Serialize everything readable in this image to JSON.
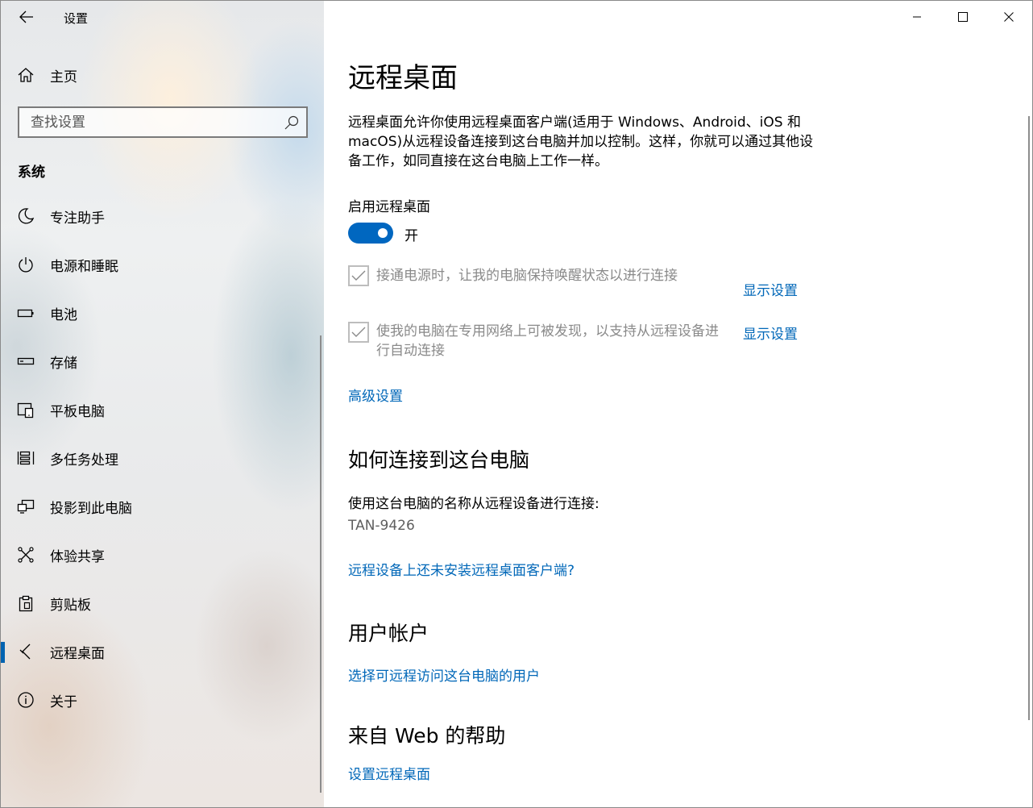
{
  "window": {
    "title": "设置",
    "controls": {
      "minimize": "minimize",
      "maximize": "maximize",
      "close": "close"
    }
  },
  "sidebar": {
    "home_label": "主页",
    "search_placeholder": "查找设置",
    "section": "系统",
    "items": [
      {
        "label": "专注助手",
        "icon": "moon-icon"
      },
      {
        "label": "电源和睡眠",
        "icon": "power-icon"
      },
      {
        "label": "电池",
        "icon": "battery-icon"
      },
      {
        "label": "存储",
        "icon": "storage-icon"
      },
      {
        "label": "平板电脑",
        "icon": "tablet-icon"
      },
      {
        "label": "多任务处理",
        "icon": "multitasking-icon"
      },
      {
        "label": "投影到此电脑",
        "icon": "project-icon"
      },
      {
        "label": "体验共享",
        "icon": "share-icon"
      },
      {
        "label": "剪贴板",
        "icon": "clipboard-icon"
      },
      {
        "label": "远程桌面",
        "icon": "remote-desktop-icon",
        "active": true
      },
      {
        "label": "关于",
        "icon": "info-icon"
      }
    ],
    "accent_color": "#0063b1"
  },
  "main": {
    "title": "远程桌面",
    "description": "远程桌面允许你使用远程桌面客户端(适用于 Windows、Android、iOS 和 macOS)从远程设备连接到这台电脑并加以控制。这样，你就可以通过其他设备工作，如同直接在这台电脑上工作一样。",
    "toggle": {
      "label": "启用远程桌面",
      "state": "开",
      "on": true
    },
    "checkbox1": {
      "text": "接通电源时，让我的电脑保持唤醒状态以进行连接",
      "link": "显示设置",
      "checked": true
    },
    "checkbox2": {
      "text_line1": "使我的电脑在专用网络上可被发现，以支持从远程设备进",
      "text_line2": "行自动连接",
      "link": "显示设置",
      "checked": true
    },
    "advanced_link": "高级设置",
    "how_to": {
      "heading": "如何连接到这台电脑",
      "text": "使用这台电脑的名称从远程设备进行连接:",
      "pc_name": "TAN-9426",
      "link": "远程设备上还未安装远程桌面客户端?"
    },
    "accounts": {
      "heading": "用户帐户",
      "link": "选择可远程访问这台电脑的用户"
    },
    "help": {
      "heading": "来自 Web 的帮助",
      "link": "设置远程桌面"
    },
    "link_color": "#0067b8",
    "toggle_color": "#0067c0"
  }
}
